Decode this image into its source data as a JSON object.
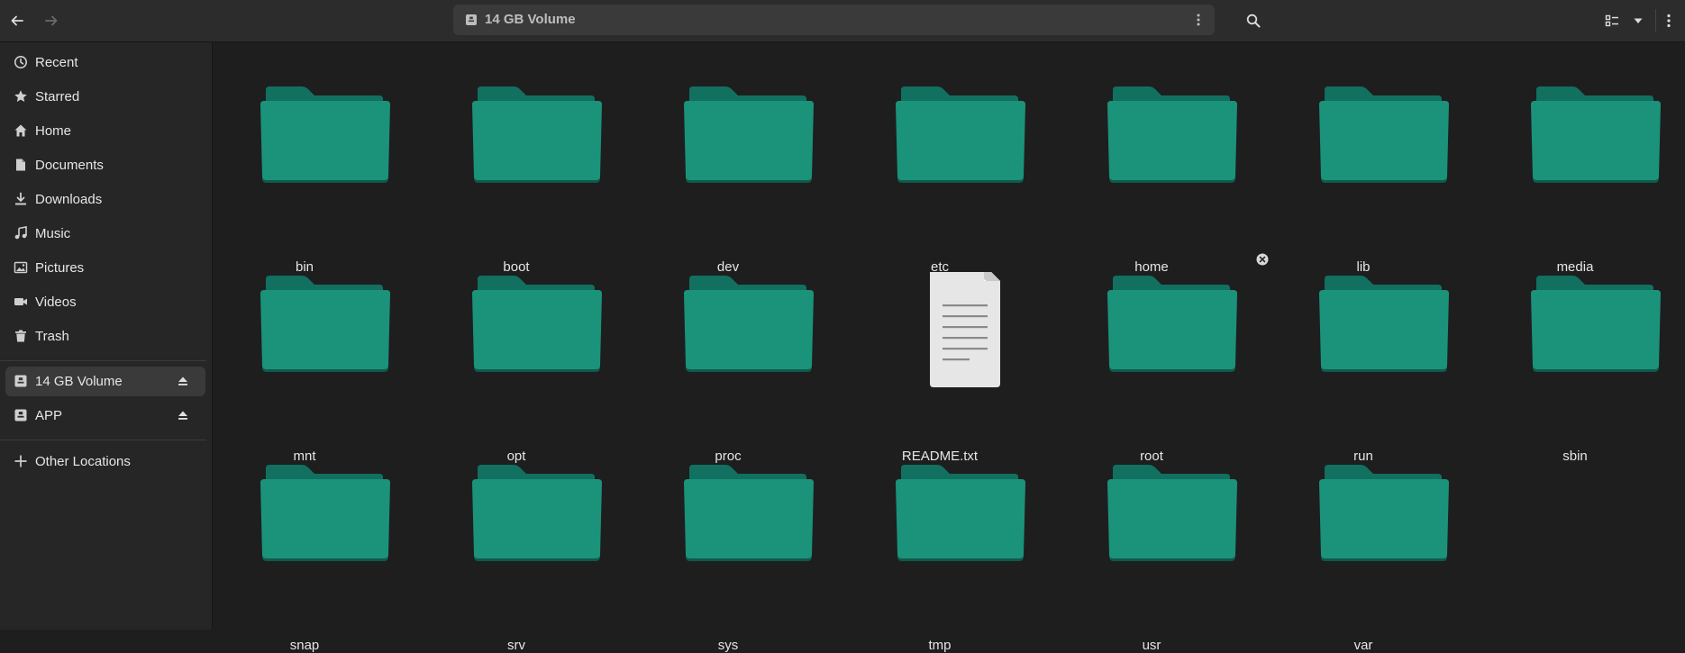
{
  "header": {
    "back_label": "Back",
    "forward_label": "Forward",
    "path": "14 GB Volume",
    "search_icon": "search-icon",
    "view_icon": "list-view-icon",
    "menu_icon": "more-vertical-icon"
  },
  "sidebar": {
    "items": [
      {
        "label": "Recent",
        "icon": "clock-icon"
      },
      {
        "label": "Starred",
        "icon": "star-icon"
      },
      {
        "label": "Home",
        "icon": "home-icon"
      },
      {
        "label": "Documents",
        "icon": "document-icon"
      },
      {
        "label": "Downloads",
        "icon": "download-icon"
      },
      {
        "label": "Music",
        "icon": "music-icon"
      },
      {
        "label": "Pictures",
        "icon": "image-icon"
      },
      {
        "label": "Videos",
        "icon": "video-icon"
      },
      {
        "label": "Trash",
        "icon": "trash-icon"
      }
    ],
    "devices": [
      {
        "label": "14 GB Volume",
        "icon": "drive-icon",
        "active": true
      },
      {
        "label": "APP",
        "icon": "drive-icon",
        "active": false
      }
    ],
    "other": {
      "label": "Other Locations",
      "icon": "plus-icon"
    }
  },
  "files": [
    {
      "name": "bin",
      "type": "folder"
    },
    {
      "name": "boot",
      "type": "folder"
    },
    {
      "name": "dev",
      "type": "folder"
    },
    {
      "name": "etc",
      "type": "folder"
    },
    {
      "name": "home",
      "type": "folder"
    },
    {
      "name": "lib",
      "type": "folder"
    },
    {
      "name": "media",
      "type": "folder"
    },
    {
      "name": "mnt",
      "type": "folder"
    },
    {
      "name": "opt",
      "type": "folder"
    },
    {
      "name": "proc",
      "type": "folder"
    },
    {
      "name": "README.txt",
      "type": "text"
    },
    {
      "name": "root",
      "type": "folder"
    },
    {
      "name": "run",
      "type": "folder"
    },
    {
      "name": "sbin",
      "type": "folder"
    },
    {
      "name": "snap",
      "type": "folder"
    },
    {
      "name": "srv",
      "type": "folder"
    },
    {
      "name": "sys",
      "type": "folder"
    },
    {
      "name": "tmp",
      "type": "folder"
    },
    {
      "name": "usr",
      "type": "folder"
    },
    {
      "name": "var",
      "type": "folder"
    }
  ],
  "colors": {
    "folder_front": "#1a937a",
    "folder_back": "#127060",
    "accent": "#1a937a"
  }
}
